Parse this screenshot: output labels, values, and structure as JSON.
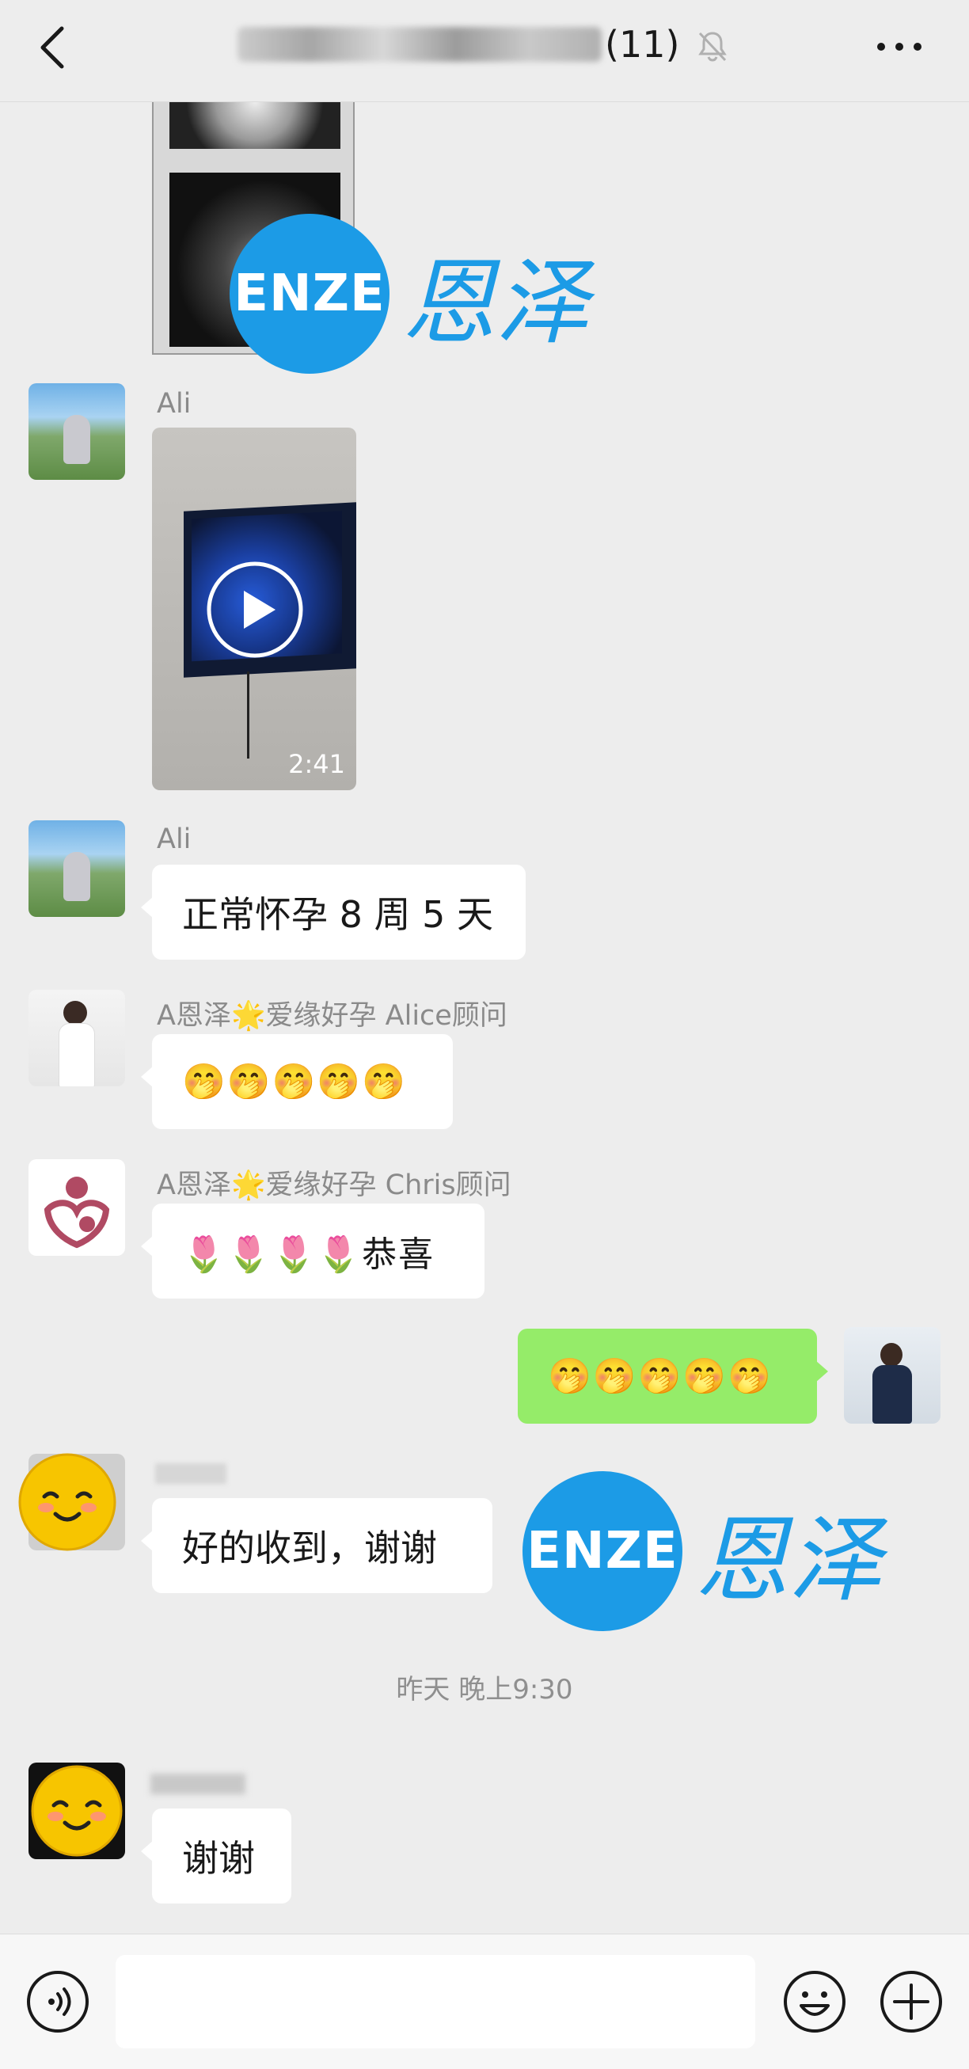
{
  "header": {
    "title_count": "(11)",
    "icons": {
      "back": "chevron-left-icon",
      "mute": "bell-off-icon",
      "more": "more-dots-icon"
    }
  },
  "messages": [
    {
      "type": "image",
      "sender": "",
      "content_desc": "ultrasound photo (partially visible)"
    },
    {
      "type": "video",
      "sender": "Ali",
      "duration": "2:41"
    },
    {
      "type": "text",
      "sender": "Ali",
      "text": "正常怀孕 8 周 5 天"
    },
    {
      "type": "text",
      "sender": "A恩泽🌟爱缘好孕 Alice顾问",
      "text": "🤭🤭🤭🤭🤭"
    },
    {
      "type": "text",
      "sender": "A恩泽🌟爱缘好孕 Chris顾问",
      "text": "🌷🌷🌷🌷恭喜"
    },
    {
      "type": "text",
      "sender": "me",
      "text": "🤭🤭🤭🤭🤭"
    },
    {
      "type": "text",
      "sender": "",
      "text": "好的收到，谢谢"
    },
    {
      "type": "text",
      "sender": "",
      "text": "谢谢"
    }
  ],
  "timestamp": "昨天 晚上9:30",
  "watermark": {
    "logo": "ENZE",
    "text": "恩泽"
  },
  "input": {
    "placeholder": ""
  },
  "colors": {
    "background": "#ededed",
    "bubble_self": "#95ec69",
    "bubble_other": "#ffffff",
    "brand_blue": "#1c9be6"
  }
}
